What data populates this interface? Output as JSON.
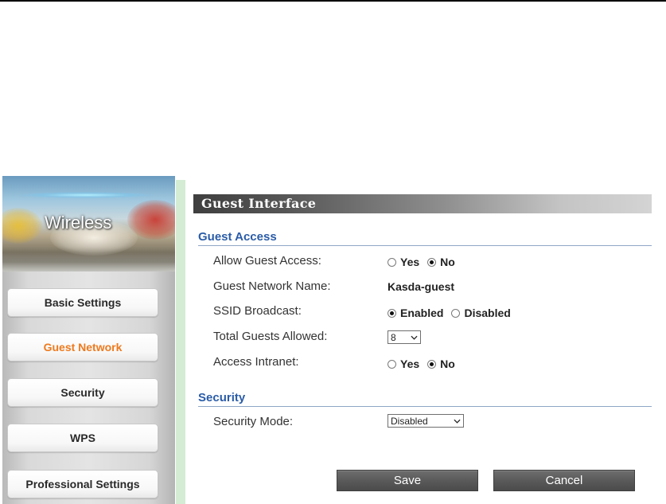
{
  "sidebar": {
    "banner_title": "Wireless",
    "items": [
      {
        "label": "Basic Settings",
        "active": false
      },
      {
        "label": "Guest Network",
        "active": true
      },
      {
        "label": "Security",
        "active": false
      },
      {
        "label": "WPS",
        "active": false
      },
      {
        "label": "Professional Settings",
        "active": false
      }
    ],
    "active_color": "#ee7a1e"
  },
  "main": {
    "header_title": "Guest Interface",
    "guest_access": {
      "title": "Guest Access",
      "allow_guest_access": {
        "label": "Allow Guest Access:",
        "yes": "Yes",
        "no": "No",
        "selected": "No"
      },
      "guest_network_name": {
        "label": "Guest Network Name:",
        "value": "Kasda-guest"
      },
      "ssid_broadcast": {
        "label": "SSID Broadcast:",
        "enabled": "Enabled",
        "disabled": "Disabled",
        "selected": "Enabled"
      },
      "total_guests_allowed": {
        "label": "Total Guests Allowed:",
        "value": "8"
      },
      "access_intranet": {
        "label": "Access Intranet:",
        "yes": "Yes",
        "no": "No",
        "selected": "No"
      }
    },
    "security": {
      "title": "Security",
      "security_mode": {
        "label": "Security Mode:",
        "value": "Disabled"
      }
    },
    "buttons": {
      "save": "Save",
      "cancel": "Cancel"
    },
    "section_title_color": "#2a5ca8"
  }
}
